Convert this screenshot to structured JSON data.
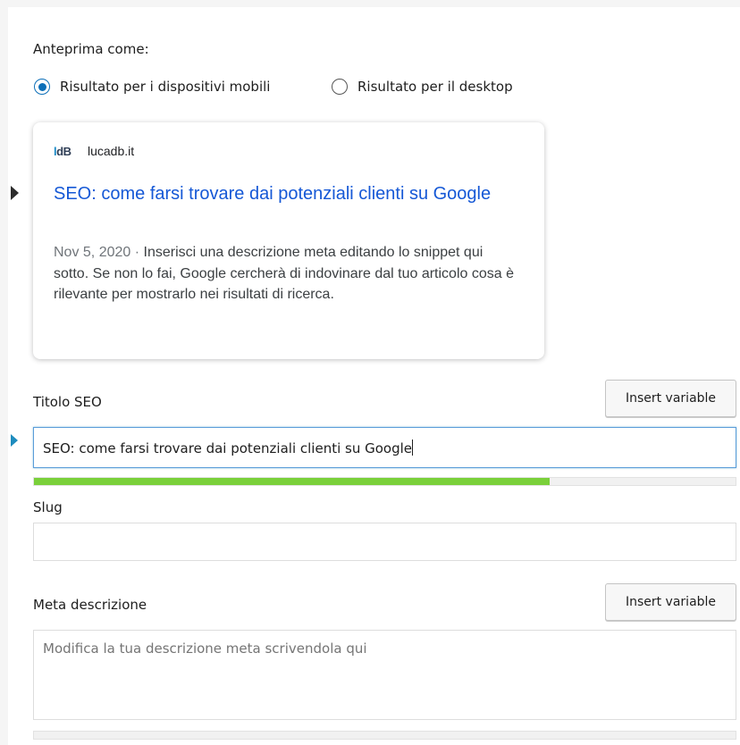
{
  "preview": {
    "label": "Anteprima come:",
    "options": [
      {
        "label": "Risultato per i dispositivi mobili",
        "selected": true
      },
      {
        "label": "Risultato per il desktop",
        "selected": false
      }
    ]
  },
  "serp": {
    "logo_text_l": "l",
    "logo_text_rest": "dB",
    "site": "lucadb.it",
    "title": "SEO: come farsi trovare dai potenziali clienti su Google",
    "date": "Nov 5, 2020 · ",
    "description": "Inserisci una descrizione meta editando lo snippet qui sotto. Se non lo fai, Google cercherà di indovinare dal tuo articolo cosa è rilevante per mostrarlo nei risultati di ricerca.",
    "title_color": "#1558d6"
  },
  "seo_title": {
    "label": "Titolo SEO",
    "insert_button": "Insert variable",
    "value": "SEO: come farsi trovare dai potenziali clienti su Google",
    "progress_fraction": 0.735,
    "progress_color": "#7ad03a"
  },
  "slug": {
    "label": "Slug",
    "value": ""
  },
  "meta": {
    "label": "Meta descrizione",
    "insert_button": "Insert variable",
    "placeholder": "Modifica la tua descrizione meta scrivendola qui",
    "progress_fraction": 0
  }
}
